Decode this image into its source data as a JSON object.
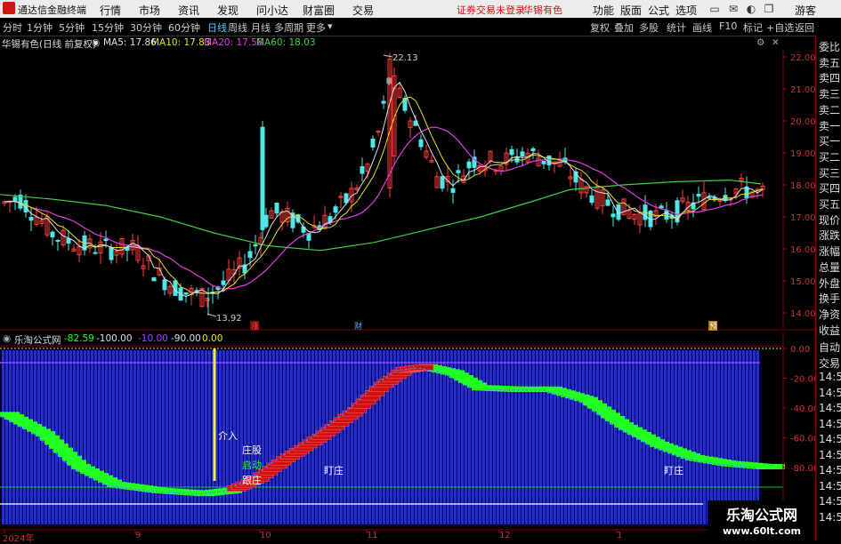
{
  "app": {
    "title": "通达信金融终端",
    "menus": [
      "行情",
      "市场",
      "资讯",
      "发现",
      "问小达",
      "财富圈",
      "交易"
    ],
    "warning": "证券交易未登录",
    "stock_name": "华锡有色",
    "right_menus": [
      "功能",
      "版面",
      "公式",
      "选项"
    ],
    "guest": "游客"
  },
  "period_tabs": [
    "分时",
    "1分钟",
    "5分钟",
    "15分钟",
    "30分钟",
    "60分钟",
    "日线",
    "周线",
    "月线",
    "多周期",
    "更多"
  ],
  "active_period": "日线",
  "right_tabs": [
    "复权",
    "叠加",
    "多股",
    "统计",
    "画线",
    "F10",
    "标记",
    "+自选",
    "返回"
  ],
  "chart_header": {
    "title": "华锡有色(日线 前复权)",
    "ma5": "MA5: 17.86",
    "ma10": "MA10: 17.83",
    "ma20": "MA20: 17.58",
    "ma60": "MA60: 18.03"
  },
  "colors": {
    "up": "#ff3c3c",
    "down": "#4ee8e8",
    "ma5": "#e0e0e0",
    "ma10": "#e8e020",
    "ma20": "#e040e0",
    "ma60": "#40d040",
    "ind_green": "#20ff20",
    "ind_red": "#d01010",
    "ind_blue": "#2030c0",
    "purple_line": "#a040ff"
  },
  "markers": {
    "high_label": "22.13",
    "low_label": "13.92",
    "event_zhang": "涨",
    "event_cai": "财",
    "event_yu": "预"
  },
  "indicator": {
    "name": "乐淘公式网",
    "v1": "-82.59",
    "v2": "-100.00",
    "v3": "-10.00",
    "v4": "-90.00",
    "v5": "0.00",
    "annot_jieru": "介入",
    "annot_zhuanggu": "庄股",
    "annot_qidong": "启动",
    "annot_genzhuang": "跟庄",
    "annot_dingzhuang1": "盯庄",
    "annot_dingzhuang2": "盯庄"
  },
  "price_axis": [
    "22.00",
    "21.00",
    "20.00",
    "19.00",
    "18.00",
    "17.00",
    "16.00",
    "15.00",
    "14.00"
  ],
  "ind_axis": [
    "0.00",
    "-20.00",
    "-40.00",
    "-60.00",
    "-80.00"
  ],
  "right_panel": [
    "委比",
    "卖五",
    "卖四",
    "卖三",
    "卖二",
    "卖一",
    "买一",
    "买二",
    "买三",
    "买四",
    "买五",
    "现价",
    "涨跌",
    "涨幅",
    "总量",
    "外盘",
    "换手",
    "净资",
    "收益"
  ],
  "right_panel_lower": [
    "自动",
    "交易",
    "14:5",
    "14:5",
    "14:5",
    "14:5",
    "14:5",
    "14:5",
    "14:5",
    "14:5",
    "14:5",
    "14:5"
  ],
  "x_axis": [
    "2024年",
    "9",
    "10",
    "11",
    "12",
    "1"
  ],
  "watermark": {
    "line1": "乐淘公式网",
    "line2": "www.60lt.com"
  }
}
